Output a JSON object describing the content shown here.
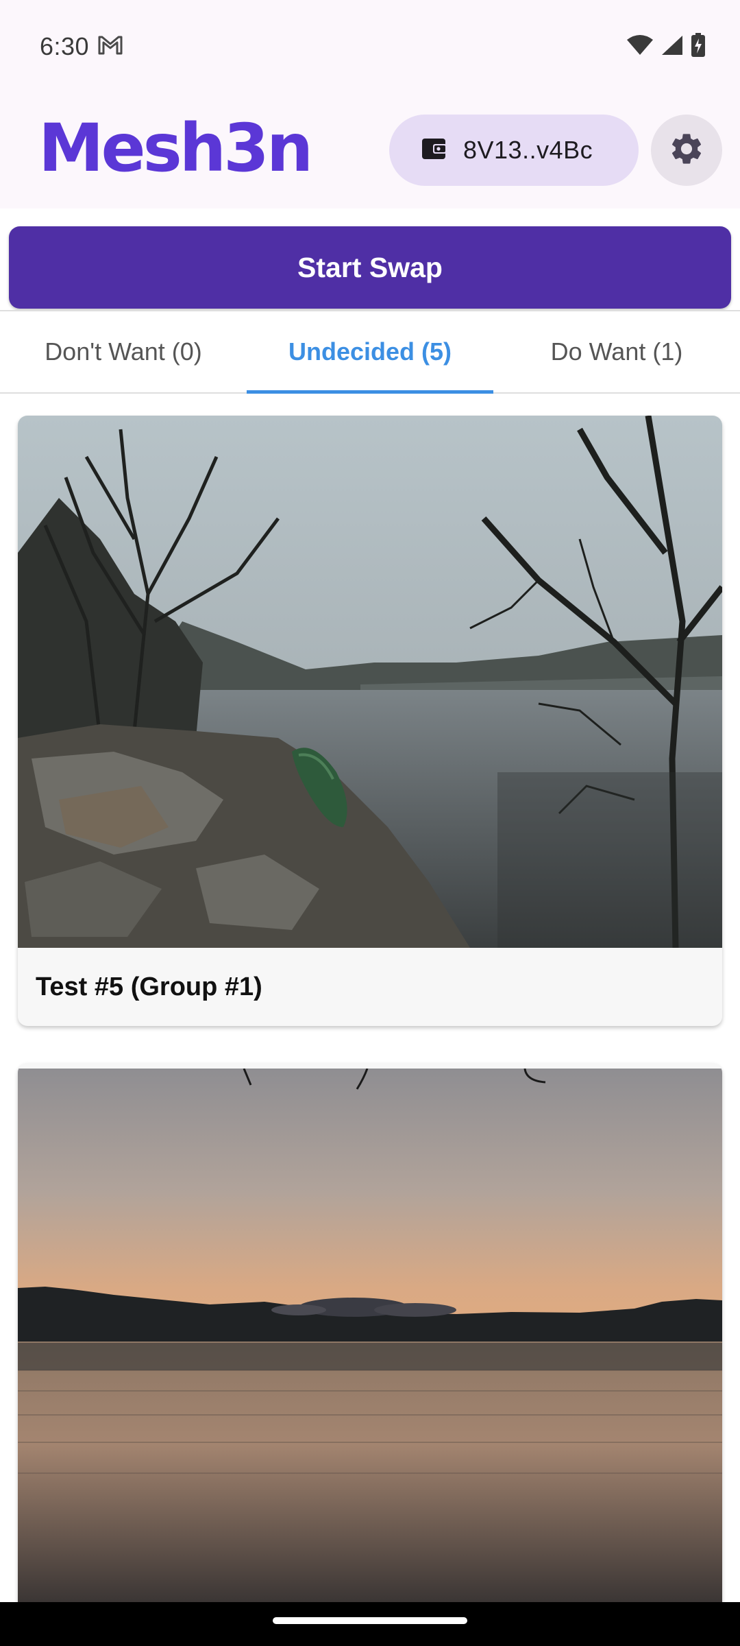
{
  "status_bar": {
    "time": "6:30",
    "icons": [
      "gmail-icon",
      "wifi-icon",
      "signal-icon",
      "battery-charging-icon"
    ]
  },
  "app_bar": {
    "title": "Mesh3n",
    "wallet_address": "8V13..v4Bc",
    "wallet_icon": "wallet-icon",
    "settings_icon": "gear-icon"
  },
  "actions": {
    "start_swap_label": "Start Swap"
  },
  "tabs": [
    {
      "label": "Don't Want (0)",
      "active": false
    },
    {
      "label": "Undecided (5)",
      "active": true
    },
    {
      "label": "Do Want (1)",
      "active": false
    }
  ],
  "cards": [
    {
      "caption": "Test #5 (Group #1)",
      "image": "lake-shore-with-canoe-photo"
    },
    {
      "caption": "",
      "image": "lake-sunset-photo"
    }
  ],
  "colors": {
    "brand": "#5b37d6",
    "primary_button": "#4f2fa5",
    "tab_active": "#3c8fe3",
    "wallet_pill": "#e6dcf5"
  }
}
